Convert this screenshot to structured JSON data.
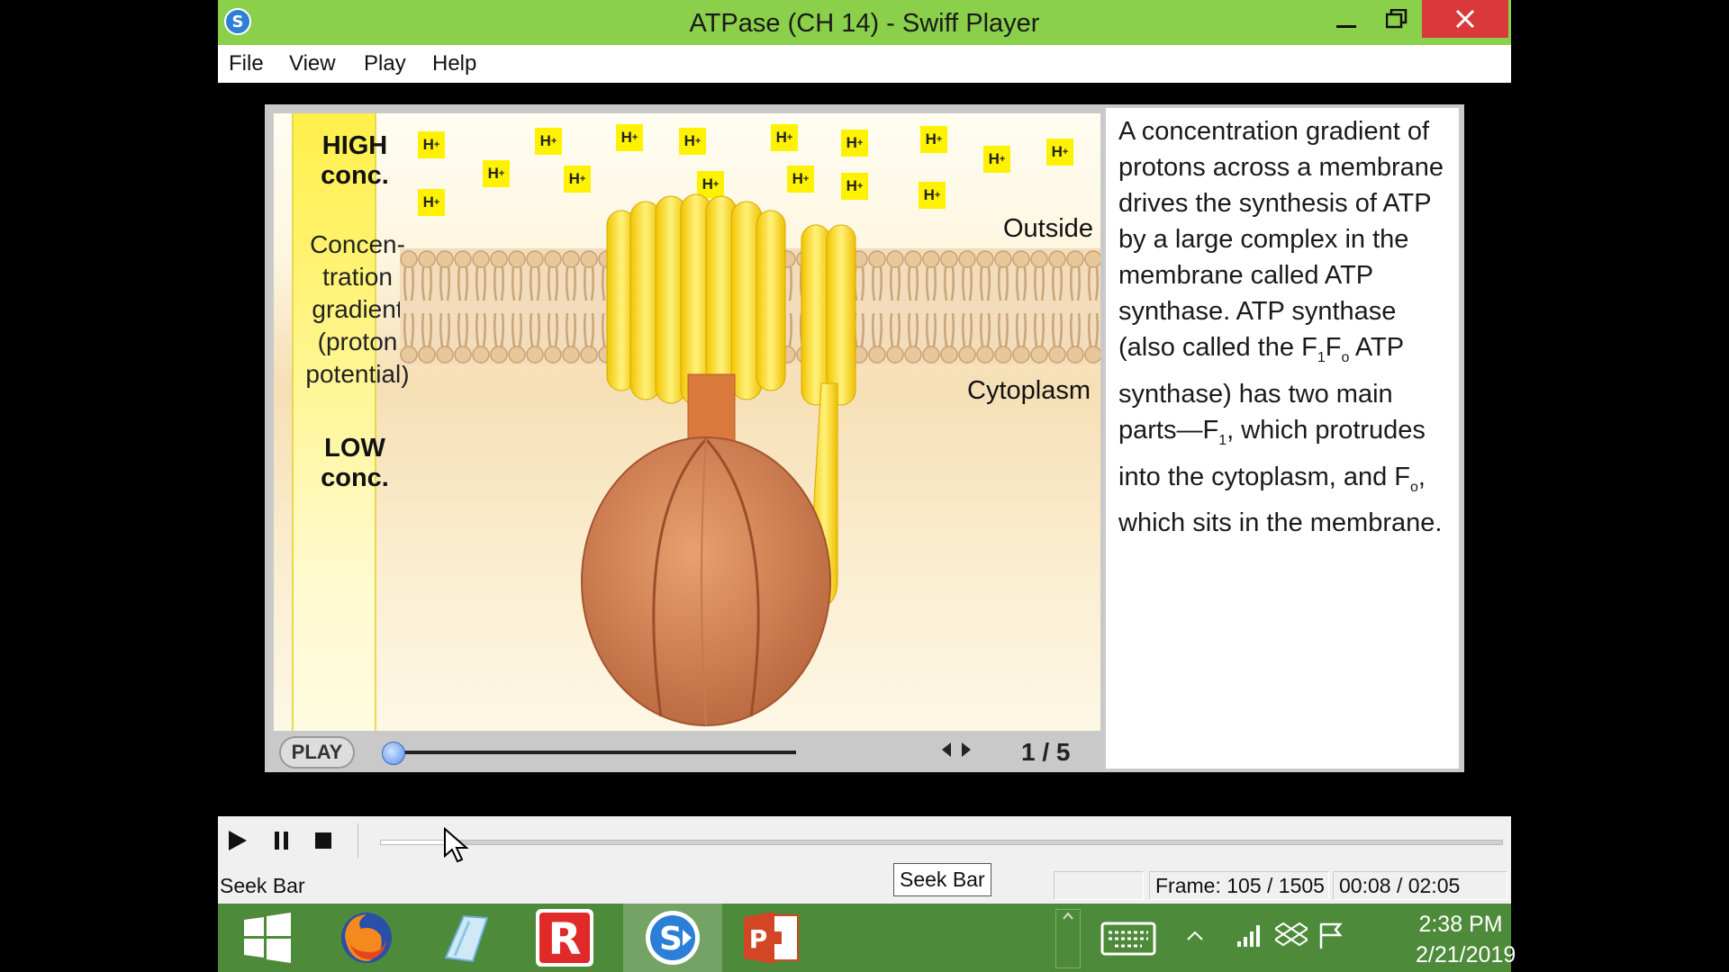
{
  "window": {
    "title": "ATPase (CH 14) - Swiff Player"
  },
  "menu": [
    "File",
    "View",
    "Play",
    "Help"
  ],
  "diagram": {
    "gradient_high": "HIGH conc.",
    "gradient_middle": "Concen-tration gradient (proton potential)",
    "gradient_low": "LOW conc.",
    "ion_label": "H",
    "ion_charge": "+",
    "outside_label": "Outside",
    "cytoplasm_label": "Cytoplasm"
  },
  "inner_player": {
    "play_label": "PLAY",
    "page_counter": "1 / 5",
    "progress": 0.0
  },
  "description": {
    "part1": "A concentration gradient of protons across a membrane drives the synthesis of ATP by a large complex in the membrane called ATP synthase. ATP synthase (also called the F",
    "sub1": "1",
    "part2": "F",
    "sub2": "o",
    "part3": " ATP synthase) has two main parts—F",
    "sub3": "1",
    "part4": ", which protrudes into the cytoplasm, and F",
    "sub4": "o",
    "part5": ", which sits in the membrane."
  },
  "status": {
    "left_text": "Seek Bar",
    "tooltip": "Seek Bar",
    "frame": "Frame: 105 / 1505",
    "time": "00:08 / 02:05",
    "seek_progress": 0.07
  },
  "taskbar": {
    "apps": [
      "start",
      "firefox",
      "notepad",
      "r-app",
      "swiff-player",
      "powerpoint"
    ],
    "time": "2:38 PM",
    "date": "2/21/2019"
  },
  "colors": {
    "titlebar": "#8bd04b",
    "close_button": "#d9393a",
    "taskbar": "#4d8a3a",
    "proton": "#fff200"
  }
}
